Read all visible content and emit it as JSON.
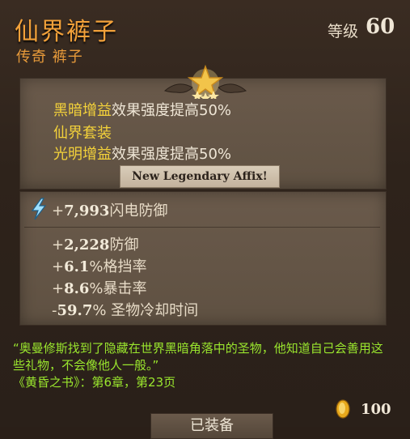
{
  "item": {
    "name": "仙界裤子",
    "type": "传奇 裤子",
    "level_label": "等级",
    "level_value": "60"
  },
  "affixes": [
    {
      "highlight": "黑暗增益",
      "text": "效果强度提高50%"
    },
    {
      "highlight": "仙界套装",
      "text": ""
    },
    {
      "highlight": "光明增益",
      "text": "效果强度提高50%"
    }
  ],
  "new_affix_label": "New Legendary Affix!",
  "primary_stat": {
    "sign": "+",
    "value": "7,993",
    "label": "闪电防御",
    "icon": "lightning-icon"
  },
  "stats": [
    {
      "sign": "+",
      "value": "2,228",
      "unit": "",
      "label": "防御"
    },
    {
      "sign": "+",
      "value": "6.1",
      "unit": "%",
      "label": "格挡率"
    },
    {
      "sign": "+",
      "value": "8.6",
      "unit": "%",
      "label": "暴击率"
    },
    {
      "sign": "-",
      "value": "59.7",
      "unit": "%",
      "label": " 圣物冷却时间"
    }
  ],
  "flavor": {
    "quote": "“奥曼修斯找到了隐藏在世界黑暗角落中的圣物，他知道自己会善用这些礼物，不会像他人一般。”",
    "source": "《黄昏之书》：第6章，第23页"
  },
  "gold": {
    "value": "100",
    "icon": "gold-coin-icon"
  },
  "equip_button_label": "已装备",
  "colors": {
    "title": "#f2a13a",
    "affix_highlight": "#f4d23a",
    "flavor_text": "#9ae62e",
    "panel": "#655646"
  }
}
